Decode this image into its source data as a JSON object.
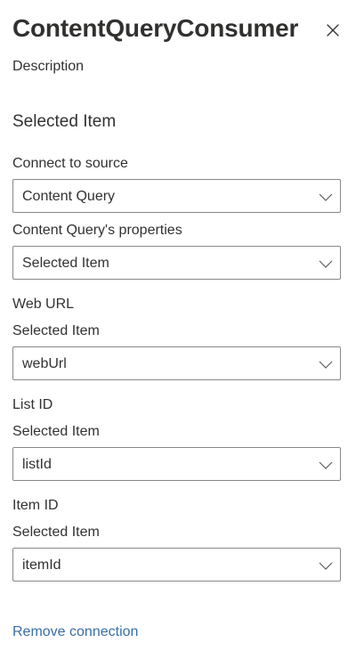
{
  "panel": {
    "title": "ContentQueryConsumer",
    "description": "Description",
    "section_title": "Selected Item",
    "close_icon": "close-icon"
  },
  "source": {
    "label": "Connect to source",
    "value": "Content Query"
  },
  "properties": {
    "label": "Content Query's properties",
    "value": "Selected Item"
  },
  "web_url": {
    "label": "Web URL",
    "sublabel": "Selected Item",
    "value": "webUrl"
  },
  "list_id": {
    "label": "List ID",
    "sublabel": "Selected Item",
    "value": "listId"
  },
  "item_id": {
    "label": "Item ID",
    "sublabel": "Selected Item",
    "value": "itemId"
  },
  "footer": {
    "remove_label": "Remove connection"
  },
  "colors": {
    "text": "#323130",
    "border": "#8a8886",
    "link": "#3a6ea5"
  }
}
